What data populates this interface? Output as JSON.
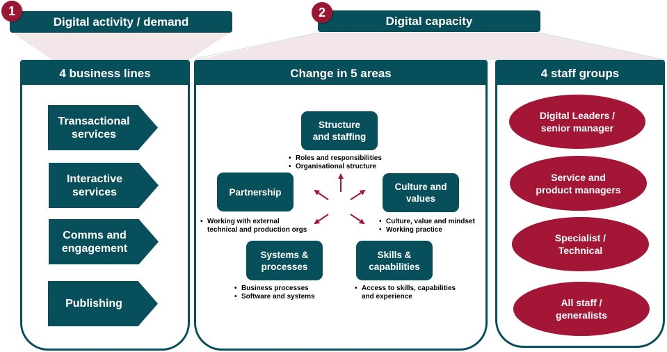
{
  "sections": [
    {
      "number": "1",
      "title": "Digital activity / demand"
    },
    {
      "number": "2",
      "title": "Digital capacity"
    }
  ],
  "business_lines": {
    "title": "4 business lines",
    "items": [
      {
        "line1": "Transactional",
        "line2": "services"
      },
      {
        "line1": "Interactive",
        "line2": "services"
      },
      {
        "line1": "Comms and",
        "line2": "engagement"
      },
      {
        "line1": "Publishing",
        "line2": ""
      }
    ]
  },
  "change_areas": {
    "title": "Change in 5 areas",
    "areas": [
      {
        "line1": "Structure",
        "line2": "and staffing",
        "bullets": [
          "Roles and responsibilities",
          "Organisational structure"
        ]
      },
      {
        "line1": "Partnership",
        "line2": "",
        "bullets": [
          "Working with external",
          "technical and production orgs"
        ]
      },
      {
        "line1": "Culture and",
        "line2": "values",
        "bullets": [
          "Culture, value and mindset",
          "Working practice"
        ]
      },
      {
        "line1": "Systems &",
        "line2": "processes",
        "bullets": [
          "Business processes",
          "Software and systems"
        ]
      },
      {
        "line1": "Skills &",
        "line2": "capabilities",
        "bullets": [
          "Access to skills, capabilities",
          "and experience"
        ]
      }
    ]
  },
  "staff_groups": {
    "title": "4 staff groups",
    "items": [
      {
        "line1": "Digital Leaders /",
        "line2": "senior manager"
      },
      {
        "line1": "Service and",
        "line2": "product managers"
      },
      {
        "line1": "Specialist /",
        "line2": "Technical"
      },
      {
        "line1": "All staff /",
        "line2": "generalists"
      }
    ]
  },
  "colors": {
    "teal": "#074f5b",
    "crimson": "#a31635",
    "badge": "#9a1733",
    "connector_fill": "#f3e6e8"
  }
}
